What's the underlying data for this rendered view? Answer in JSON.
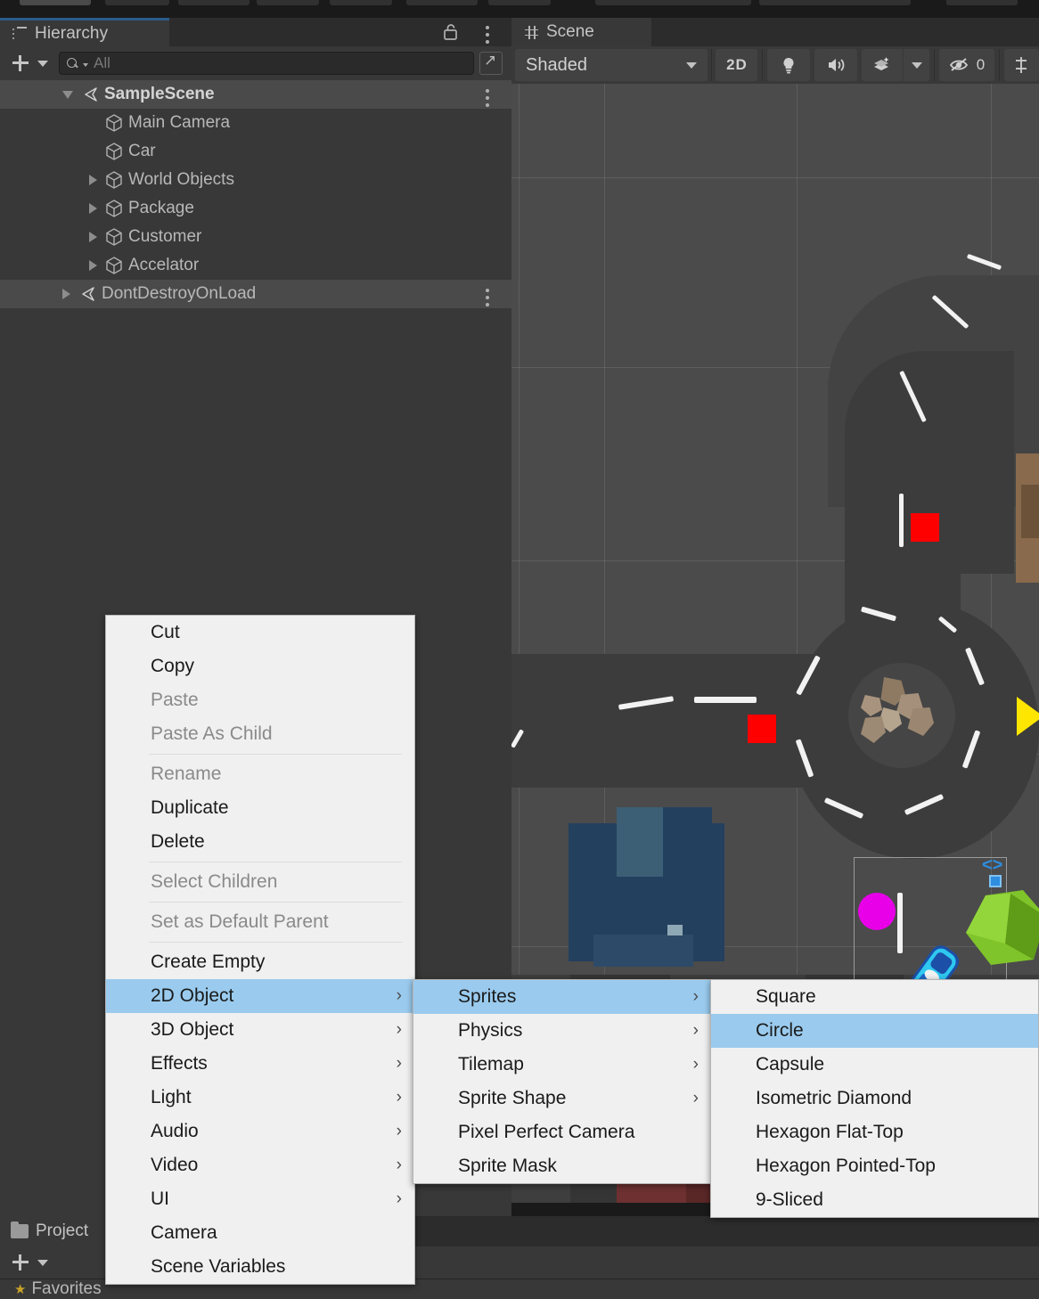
{
  "app": {
    "theme": "unity-dark"
  },
  "hierarchy": {
    "tab_label": "Hierarchy",
    "tab_icon": "list-tree-icon",
    "lock_icon": "lock-open-icon",
    "menu_icon": "kebab-menu-icon",
    "add_button_icon": "plus-icon",
    "add_dropdown_icon": "chevron-down-icon",
    "search": {
      "placeholder": "All",
      "value": "",
      "icon": "search-icon"
    },
    "expand_icon": "open-in-new-icon",
    "rows": [
      {
        "label": "SampleScene",
        "indent": 0,
        "arrow": "down",
        "icon": "unity-scene-icon",
        "selected": true,
        "kebab": true,
        "bold": true
      },
      {
        "label": "Main Camera",
        "indent": 1,
        "arrow": "none",
        "icon": "gameobject-cube-icon",
        "selected": false,
        "kebab": false,
        "bold": false
      },
      {
        "label": "Car",
        "indent": 1,
        "arrow": "none",
        "icon": "gameobject-cube-icon",
        "selected": false,
        "kebab": false,
        "bold": false
      },
      {
        "label": "World Objects",
        "indent": 1,
        "arrow": "right",
        "icon": "gameobject-cube-icon",
        "selected": false,
        "kebab": false,
        "bold": false
      },
      {
        "label": "Package",
        "indent": 1,
        "arrow": "right",
        "icon": "gameobject-cube-icon",
        "selected": false,
        "kebab": false,
        "bold": false
      },
      {
        "label": "Customer",
        "indent": 1,
        "arrow": "right",
        "icon": "gameobject-cube-icon",
        "selected": false,
        "kebab": false,
        "bold": false
      },
      {
        "label": "Accelator",
        "indent": 1,
        "arrow": "right",
        "icon": "gameobject-cube-icon",
        "selected": false,
        "kebab": false,
        "bold": false
      },
      {
        "label": "DontDestroyOnLoad",
        "indent": 0,
        "arrow": "right",
        "icon": "unity-scene-icon",
        "selected": true,
        "kebab": true,
        "bold": false
      }
    ]
  },
  "scene": {
    "tab_label": "Scene",
    "tab_icon": "grid-hash-icon",
    "toolbar": {
      "draw_mode": "Shaded",
      "draw_mode_caret": "chevron-down-icon",
      "toggle_2d": "2D",
      "lighting_icon": "lightbulb-icon",
      "audio_icon": "speaker-icon",
      "fx_icon": "effects-icon",
      "fx_caret": "chevron-down-icon",
      "hidden_objects_icon": "eye-off-icon",
      "hidden_objects_count": "0",
      "gizmos_icon": "gizmos-icon"
    }
  },
  "project": {
    "tab_label": "Project",
    "tab_icon": "folder-icon",
    "add_button_icon": "plus-icon",
    "add_dropdown_icon": "chevron-down-icon",
    "favorites_label": "Favorites",
    "favorites_icon": "star-icon"
  },
  "context_menu": {
    "highlight_color": "#9acbee",
    "background_color": "#f0f0f0",
    "level1": {
      "name": "gameobject-context-menu",
      "items": [
        {
          "label": "Cut",
          "disabled": false,
          "submenu": false,
          "highlighted": false,
          "sep_after": false
        },
        {
          "label": "Copy",
          "disabled": false,
          "submenu": false,
          "highlighted": false,
          "sep_after": false
        },
        {
          "label": "Paste",
          "disabled": true,
          "submenu": false,
          "highlighted": false,
          "sep_after": false
        },
        {
          "label": "Paste As Child",
          "disabled": true,
          "submenu": false,
          "highlighted": false,
          "sep_after": true
        },
        {
          "label": "Rename",
          "disabled": true,
          "submenu": false,
          "highlighted": false,
          "sep_after": false
        },
        {
          "label": "Duplicate",
          "disabled": false,
          "submenu": false,
          "highlighted": false,
          "sep_after": false
        },
        {
          "label": "Delete",
          "disabled": false,
          "submenu": false,
          "highlighted": false,
          "sep_after": true
        },
        {
          "label": "Select Children",
          "disabled": true,
          "submenu": false,
          "highlighted": false,
          "sep_after": true
        },
        {
          "label": "Set as Default Parent",
          "disabled": true,
          "submenu": false,
          "highlighted": false,
          "sep_after": true
        },
        {
          "label": "Create Empty",
          "disabled": false,
          "submenu": false,
          "highlighted": false,
          "sep_after": false
        },
        {
          "label": "2D Object",
          "disabled": false,
          "submenu": true,
          "highlighted": true,
          "sep_after": false
        },
        {
          "label": "3D Object",
          "disabled": false,
          "submenu": true,
          "highlighted": false,
          "sep_after": false
        },
        {
          "label": "Effects",
          "disabled": false,
          "submenu": true,
          "highlighted": false,
          "sep_after": false
        },
        {
          "label": "Light",
          "disabled": false,
          "submenu": true,
          "highlighted": false,
          "sep_after": false
        },
        {
          "label": "Audio",
          "disabled": false,
          "submenu": true,
          "highlighted": false,
          "sep_after": false
        },
        {
          "label": "Video",
          "disabled": false,
          "submenu": true,
          "highlighted": false,
          "sep_after": false
        },
        {
          "label": "UI",
          "disabled": false,
          "submenu": true,
          "highlighted": false,
          "sep_after": false
        },
        {
          "label": "Camera",
          "disabled": false,
          "submenu": false,
          "highlighted": false,
          "sep_after": false
        },
        {
          "label": "Scene Variables",
          "disabled": false,
          "submenu": false,
          "highlighted": false,
          "sep_after": false
        }
      ]
    },
    "level2": {
      "name": "2d-object-submenu",
      "items": [
        {
          "label": "Sprites",
          "disabled": false,
          "submenu": true,
          "highlighted": true
        },
        {
          "label": "Physics",
          "disabled": false,
          "submenu": true,
          "highlighted": false
        },
        {
          "label": "Tilemap",
          "disabled": false,
          "submenu": true,
          "highlighted": false
        },
        {
          "label": "Sprite Shape",
          "disabled": false,
          "submenu": true,
          "highlighted": false
        },
        {
          "label": "Pixel Perfect Camera",
          "disabled": false,
          "submenu": false,
          "highlighted": false
        },
        {
          "label": "Sprite Mask",
          "disabled": false,
          "submenu": false,
          "highlighted": false
        }
      ]
    },
    "level3": {
      "name": "sprites-submenu",
      "items": [
        {
          "label": "Square",
          "disabled": false,
          "submenu": false,
          "highlighted": false
        },
        {
          "label": "Circle",
          "disabled": false,
          "submenu": false,
          "highlighted": true
        },
        {
          "label": "Capsule",
          "disabled": false,
          "submenu": false,
          "highlighted": false
        },
        {
          "label": "Isometric Diamond",
          "disabled": false,
          "submenu": false,
          "highlighted": false
        },
        {
          "label": "Hexagon Flat-Top",
          "disabled": false,
          "submenu": false,
          "highlighted": false
        },
        {
          "label": "Hexagon Pointed-Top",
          "disabled": false,
          "submenu": false,
          "highlighted": false
        },
        {
          "label": "9-Sliced",
          "disabled": false,
          "submenu": false,
          "highlighted": false
        }
      ]
    }
  }
}
